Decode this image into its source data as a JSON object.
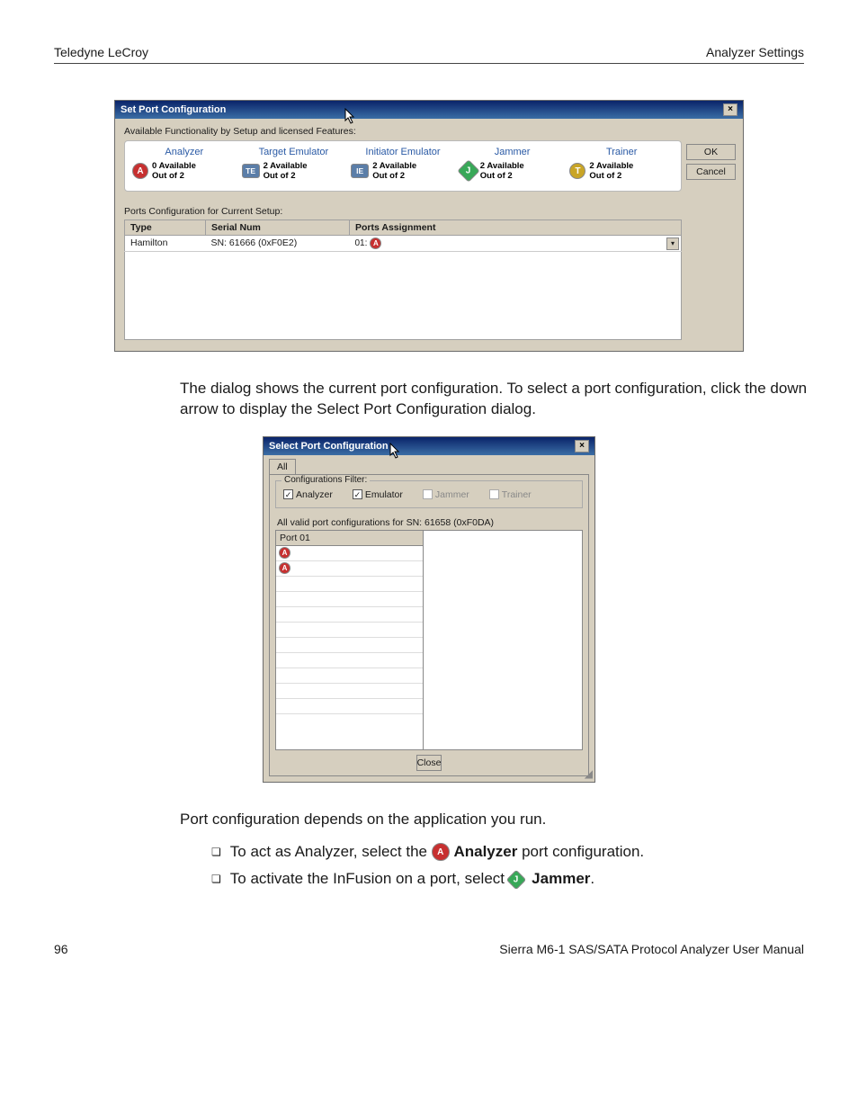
{
  "header": {
    "left": "Teledyne LeCroy",
    "right": "Analyzer Settings"
  },
  "dlg1": {
    "title": "Set Port Configuration",
    "close_x": "×",
    "avail_label": "Available Functionality by Setup and licensed Features:",
    "features": [
      {
        "name": "Analyzer",
        "badge": "A",
        "badge_class": "badge-a",
        "line1": "0 Available",
        "line2": "Out of 2"
      },
      {
        "name": "Target Emulator",
        "badge": "TE",
        "badge_class": "badge-te",
        "line1": "2 Available",
        "line2": "Out of 2"
      },
      {
        "name": "Initiator Emulator",
        "badge": "IE",
        "badge_class": "badge-ie",
        "line1": "2 Available",
        "line2": "Out of 2"
      },
      {
        "name": "Jammer",
        "badge": "J",
        "badge_class": "badge-j",
        "line1": "2 Available",
        "line2": "Out of 2"
      },
      {
        "name": "Trainer",
        "badge": "T",
        "badge_class": "badge-t",
        "line1": "2 Available",
        "line2": "Out of 2"
      }
    ],
    "ok": "OK",
    "cancel": "Cancel",
    "ports_label": "Ports Configuration for Current Setup:",
    "grid": {
      "headers": [
        "Type",
        "Serial Num",
        "Ports Assignment"
      ],
      "row": {
        "type": "Hamilton",
        "serial": "SN: 61666 (0xF0E2)",
        "assign_prefix": "01:",
        "assign_badge": "A"
      }
    }
  },
  "para1": "The dialog shows the current port configuration. To select a port configuration, click the down arrow to display the Select Port Configuration dialog.",
  "dlg2": {
    "title": "Select Port Configuration",
    "close_x": "×",
    "tab": "All",
    "fieldset_legend": "Configurations Filter:",
    "checks": [
      {
        "label": "Analyzer",
        "checked": true,
        "disabled": false
      },
      {
        "label": "Emulator",
        "checked": true,
        "disabled": false
      },
      {
        "label": "Jammer",
        "checked": false,
        "disabled": true
      },
      {
        "label": "Trainer",
        "checked": false,
        "disabled": true
      }
    ],
    "valid_label": "All valid port configurations for   SN: 61658 (0xF0DA)",
    "list_header": "Port 01",
    "close": "Close"
  },
  "para2": "Port configuration depends on the application you run.",
  "bul1_a": "To act as Analyzer, select the ",
  "bul1_b": "Analyzer",
  "bul1_c": " port configuration.",
  "bul2_a": "To activate the InFusion on a port, select ",
  "bul2_b": "Jammer",
  "bul2_c": ".",
  "footer": {
    "page": "96",
    "manual": "Sierra M6-1 SAS/SATA Protocol Analyzer User Manual"
  }
}
